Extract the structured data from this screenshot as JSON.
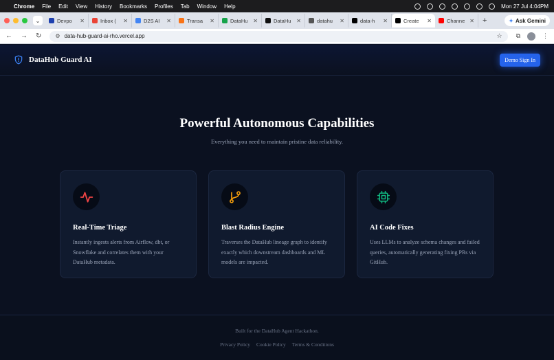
{
  "menubar": {
    "app": "Chrome",
    "items": [
      "File",
      "Edit",
      "View",
      "History",
      "Bookmarks",
      "Profiles",
      "Tab",
      "Window",
      "Help"
    ],
    "datetime": "Mon 27 Jul  4:04PM"
  },
  "tabs": [
    {
      "label": "Devpo",
      "color": "#1e40af"
    },
    {
      "label": "Inbox (",
      "color": "#ea4335"
    },
    {
      "label": "D2S AI",
      "color": "#4285f4"
    },
    {
      "label": "Transa",
      "color": "#f97316"
    },
    {
      "label": "DataHu",
      "color": "#16a34a"
    },
    {
      "label": "DataHu",
      "color": "#111111"
    },
    {
      "label": "datahu",
      "color": "#555555"
    },
    {
      "label": "data-h",
      "color": "#000000"
    },
    {
      "label": "Create",
      "color": "#000000",
      "active": true
    },
    {
      "label": "Channe",
      "color": "#ff0000"
    }
  ],
  "ask_gemini": "Ask Gemini",
  "address": {
    "url": "data-hub-guard-ai-rho.vercel.app"
  },
  "header": {
    "brand": "DataHub Guard AI",
    "signin": "Demo Sign In"
  },
  "hero": {
    "title": "Powerful Autonomous Capabilities",
    "subtitle": "Everything you need to maintain pristine data reliability."
  },
  "cards": [
    {
      "title": "Real-Time Triage",
      "desc": "Instantly ingests alerts from Airflow, dbt, or Snowflake and correlates them with your DataHub metadata.",
      "icon": "pulse-icon",
      "color": "#ef4444"
    },
    {
      "title": "Blast Radius Engine",
      "desc": "Traverses the DataHub lineage graph to identify exactly which downstream dashboards and ML models are impacted.",
      "icon": "git-branch-icon",
      "color": "#f59e0b"
    },
    {
      "title": "AI Code Fixes",
      "desc": "Uses LLMs to analyze schema changes and failed queries, automatically generating fixing PRs via GitHub.",
      "icon": "cpu-icon",
      "color": "#10b981"
    }
  ],
  "footer": {
    "built": "Built for the DataHub Agent Hackathon.",
    "links": [
      "Privacy Policy",
      "Cookie Policy",
      "Terms & Conditions"
    ]
  }
}
